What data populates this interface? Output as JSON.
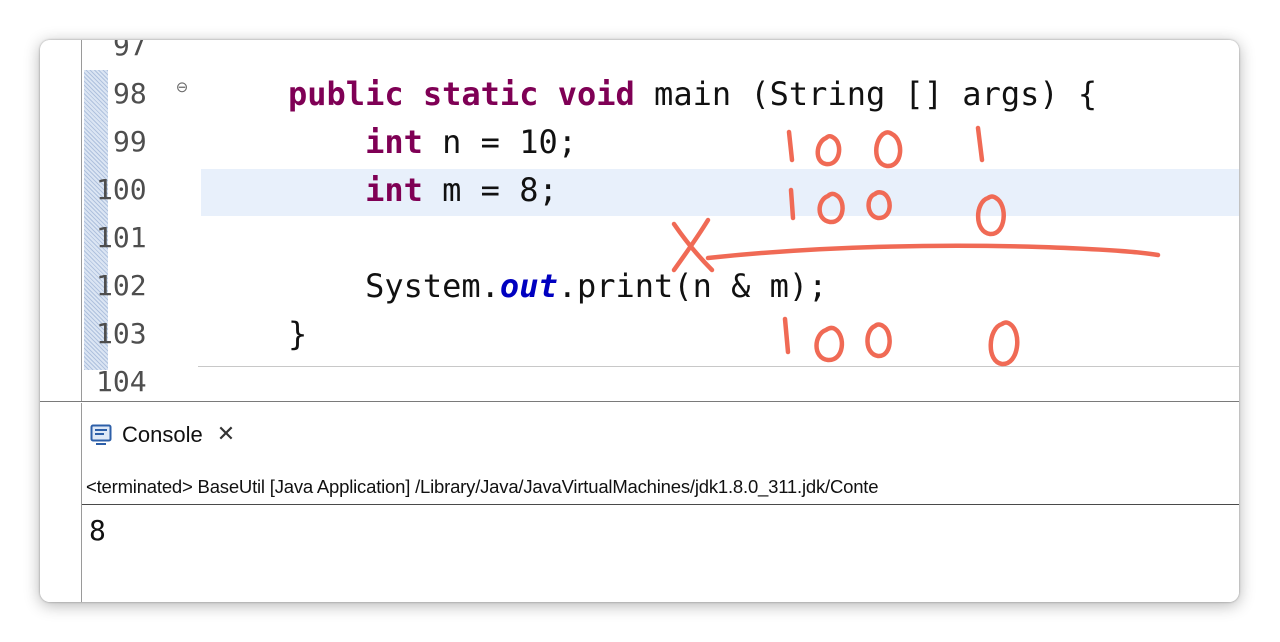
{
  "editor": {
    "lines": [
      {
        "number": "97",
        "code": []
      },
      {
        "number": "98",
        "fold": "⊖",
        "code": [
          {
            "t": "public",
            "c": "kw"
          },
          {
            "t": " "
          },
          {
            "t": "static",
            "c": "kw"
          },
          {
            "t": " "
          },
          {
            "t": "void",
            "c": "kw"
          },
          {
            "t": " main (String [] args) {"
          }
        ]
      },
      {
        "number": "99",
        "code": [
          {
            "t": "    "
          },
          {
            "t": "int",
            "c": "kw"
          },
          {
            "t": " n = 10;"
          }
        ]
      },
      {
        "number": "100",
        "current": true,
        "code": [
          {
            "t": "    "
          },
          {
            "t": "int",
            "c": "kw"
          },
          {
            "t": " m = 8;"
          }
        ]
      },
      {
        "number": "101",
        "code": []
      },
      {
        "number": "102",
        "code": [
          {
            "t": "    System."
          },
          {
            "t": "out",
            "c": "stat"
          },
          {
            "t": ".print(n & m);"
          }
        ]
      },
      {
        "number": "103",
        "code": [
          {
            "t": "}"
          }
        ]
      },
      {
        "number": "104",
        "code": []
      }
    ],
    "annotations": {
      "color": "#f06a55",
      "row1": "1001",
      "row2": "1000",
      "operator": "X",
      "result": "1000"
    }
  },
  "console": {
    "icon": "console-monitor-icon",
    "tab_label": "Console",
    "close_label": "✕",
    "status": "<terminated> BaseUtil [Java Application] /Library/Java/JavaVirtualMachines/jdk1.8.0_311.jdk/Conte",
    "output": "8"
  },
  "colors": {
    "keyword": "#7f0055",
    "static_field": "#0000c0",
    "current_line": "#e8f0fb",
    "annotation": "#f06a55"
  }
}
